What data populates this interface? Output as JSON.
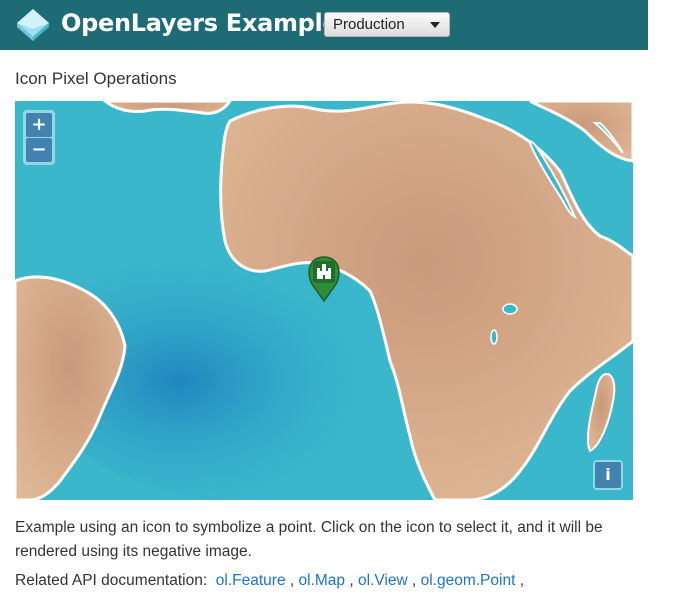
{
  "header": {
    "brand": "OpenLayers Examples",
    "version_select": {
      "selected": "Production"
    },
    "background_color": "#1f6b75"
  },
  "page_title": "Icon Pixel Operations",
  "map": {
    "zoom_in_label": "+",
    "zoom_out_label": "−",
    "attribution_label": "i",
    "marker_icon": "castle-marker-icon",
    "colors": {
      "ocean": "#38b4cb",
      "land": "#d6a886",
      "marker": "#2e8b3a"
    }
  },
  "description": "Example using an icon to symbolize a point. Click on the icon to select it, and it will be rendered using its negative image.",
  "related": {
    "label": "Related API documentation:",
    "links": [
      "ol.Feature",
      "ol.Map",
      "ol.View",
      "ol.geom.Point"
    ],
    "separator": ","
  }
}
